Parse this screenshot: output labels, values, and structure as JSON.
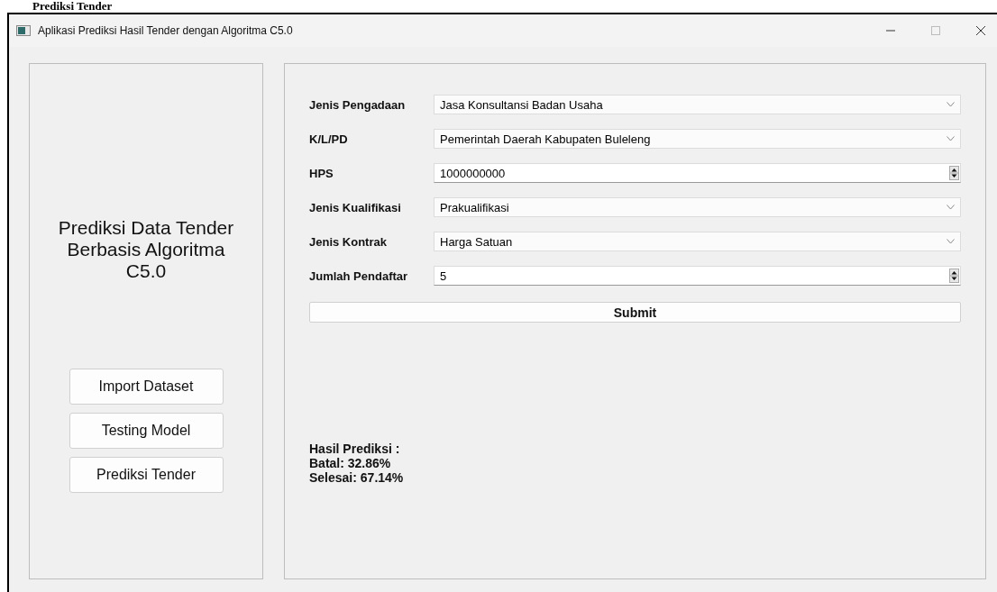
{
  "document_heading": "Prediksi Tender",
  "window": {
    "title": "Aplikasi Prediksi Hasil Tender dengan Algoritma C5.0"
  },
  "sidebar": {
    "title": "Prediksi Data Tender Berbasis Algoritma C5.0",
    "buttons": [
      "Import Dataset",
      "Testing Model",
      "Prediksi Tender"
    ]
  },
  "form": {
    "fields": [
      {
        "label": "Jenis Pengadaan",
        "value": "Jasa Konsultansi Badan Usaha",
        "kind": "combo"
      },
      {
        "label": "K/L/PD",
        "value": "Pemerintah Daerah Kabupaten Buleleng",
        "kind": "combo"
      },
      {
        "label": "HPS",
        "value": "1000000000",
        "kind": "spin"
      },
      {
        "label": "Jenis Kualifikasi",
        "value": "Prakualifikasi",
        "kind": "combo"
      },
      {
        "label": "Jenis Kontrak",
        "value": "Harga Satuan",
        "kind": "combo"
      },
      {
        "label": "Jumlah Pendaftar",
        "value": "5",
        "kind": "spin"
      }
    ],
    "submit": "Submit"
  },
  "result": {
    "lines": [
      "Hasil Prediksi :",
      "Batal: 32.86%",
      "Selesai: 67.14%"
    ]
  }
}
